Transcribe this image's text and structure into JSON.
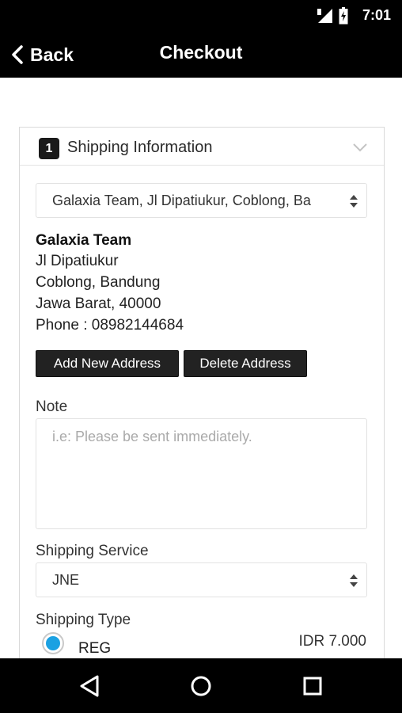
{
  "status_bar": {
    "time": "7:01"
  },
  "app_bar": {
    "back_label": "Back",
    "title": "Checkout"
  },
  "section": {
    "step_number": "1",
    "title": "Shipping Information"
  },
  "address_select": {
    "value": "Galaxia Team, Jl Dipatiukur, Coblong, Ba"
  },
  "address": {
    "name": "Galaxia Team",
    "street": "Jl Dipatiukur",
    "district": "Coblong, Bandung",
    "region": "Jawa Barat, 40000",
    "phone": "Phone : 08982144684"
  },
  "buttons": {
    "add_address": "Add New Address",
    "delete_address": "Delete Address"
  },
  "note": {
    "label": "Note",
    "placeholder": "i.e: Please be sent immediately."
  },
  "shipping_service": {
    "label": "Shipping Service",
    "value": "JNE"
  },
  "shipping_type": {
    "label": "Shipping Type",
    "option_label": "REG",
    "option_price": "IDR 7.000",
    "selected": true
  },
  "colors": {
    "accent": "#1ba1e2",
    "bar": "#000000",
    "button": "#222222"
  }
}
